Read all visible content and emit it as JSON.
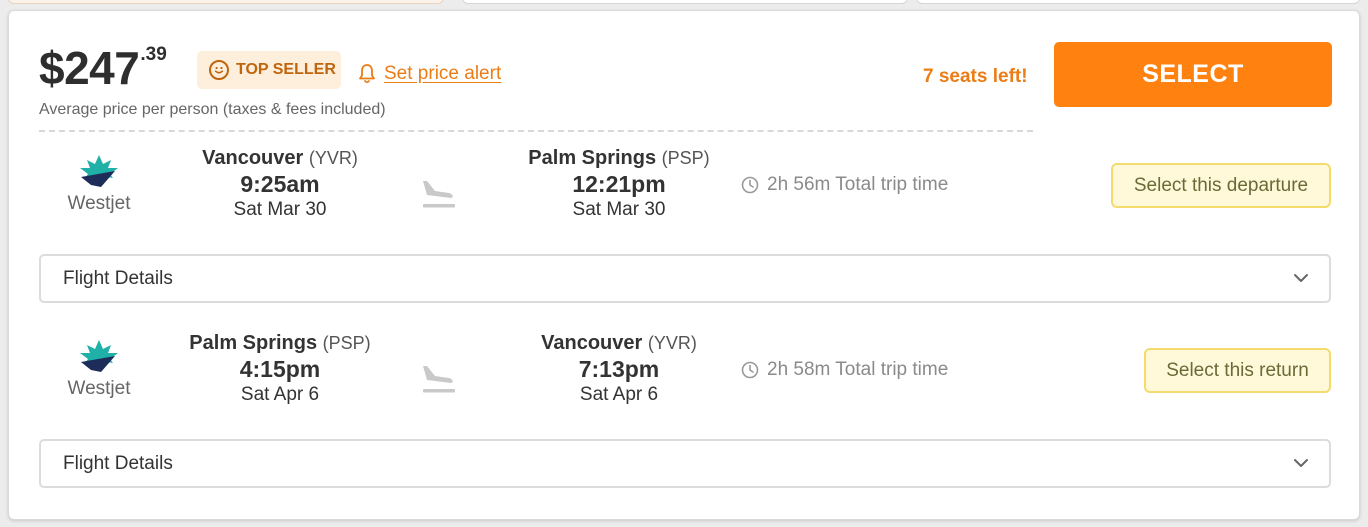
{
  "price": {
    "dollars": "$247",
    "cents": ".39",
    "note": "Average price per person (taxes & fees included)"
  },
  "badge": {
    "label": "TOP SELLER",
    "icon": "smiley-icon"
  },
  "price_alert": {
    "label": "Set price alert",
    "icon": "bell-icon"
  },
  "seats_left": "7 seats left!",
  "select_label": "SELECT",
  "colors": {
    "accent": "#ff8210",
    "alert": "#ec7d16",
    "leg_button_bg": "#fff9d9",
    "leg_button_border": "#f3db6c"
  },
  "legs": [
    {
      "airline": "Westjet",
      "origin": {
        "city": "Vancouver",
        "code": "(YVR)",
        "time": "9:25am",
        "date": "Sat Mar 30"
      },
      "destination": {
        "city": "Palm Springs",
        "code": "(PSP)",
        "time": "12:21pm",
        "date": "Sat Mar 30"
      },
      "duration": "2h 56m Total trip time",
      "select_label": "Select this departure",
      "details_label": "Flight Details"
    },
    {
      "airline": "Westjet",
      "origin": {
        "city": "Palm Springs",
        "code": "(PSP)",
        "time": "4:15pm",
        "date": "Sat Apr 6"
      },
      "destination": {
        "city": "Vancouver",
        "code": "(YVR)",
        "time": "7:13pm",
        "date": "Sat Apr 6"
      },
      "duration": "2h 58m Total trip time",
      "select_label": "Select this return",
      "details_label": "Flight Details"
    }
  ]
}
